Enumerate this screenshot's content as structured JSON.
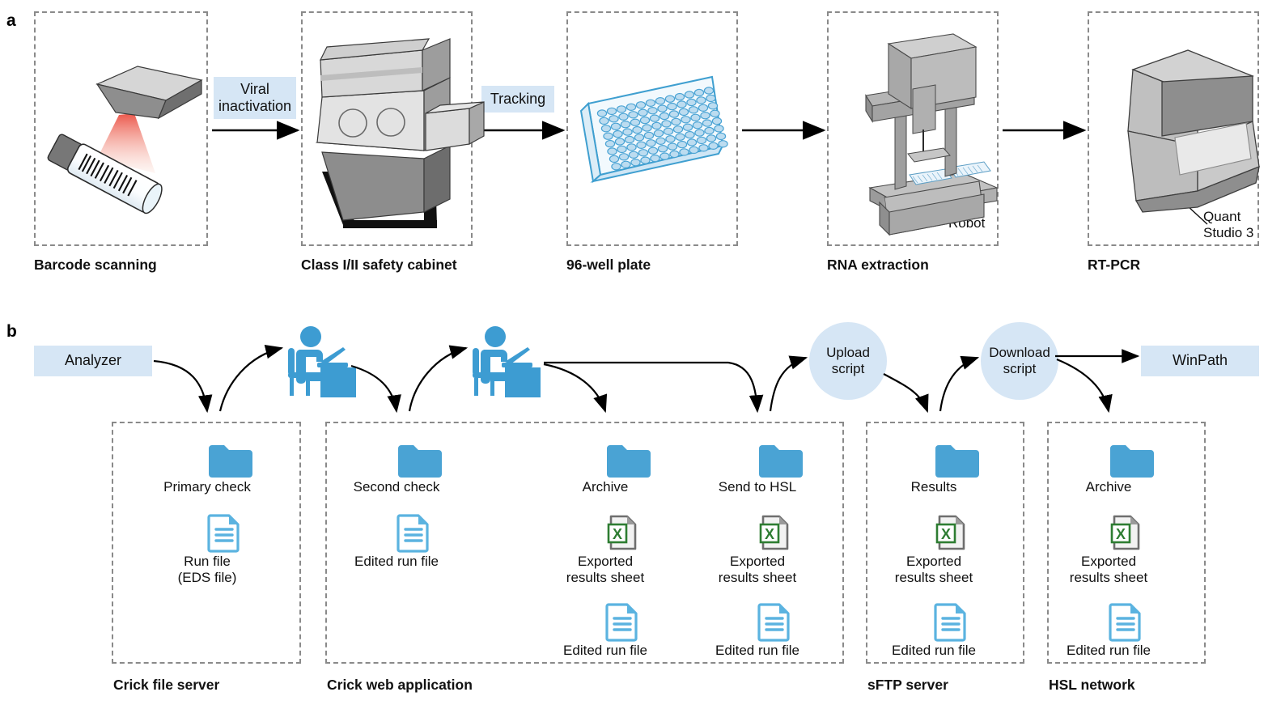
{
  "panels": {
    "a": {
      "letter": "a"
    },
    "b": {
      "letter": "b"
    }
  },
  "workflow_a": {
    "steps": [
      {
        "caption": "Barcode scanning",
        "icon": "barcode-scanner-icon"
      },
      {
        "caption": "Class I/II safety cabinet",
        "icon": "safety-cabinet-icon"
      },
      {
        "caption": "96-well plate",
        "icon": "96-well-plate-icon"
      },
      {
        "caption": "RNA extraction",
        "icon": "robot-extractor-icon",
        "annotation": "Robot"
      },
      {
        "caption": "RT-PCR",
        "icon": "thermocycler-icon",
        "annotation": "Quant\nStudio 3"
      }
    ],
    "arrow_labels": [
      {
        "text": "Viral\ninactivation"
      },
      {
        "text": "Tracking"
      }
    ]
  },
  "workflow_b": {
    "source": {
      "label": "Analyzer"
    },
    "destination": {
      "label": "WinPath"
    },
    "scripts": [
      {
        "label": "Upload\nscript"
      },
      {
        "label": "Download\nscript"
      }
    ],
    "operators": [
      {
        "name": "operator-primary-check",
        "icon": "person-at-desk-icon"
      },
      {
        "name": "operator-second-check",
        "icon": "person-at-desk-icon"
      }
    ],
    "containers": [
      {
        "label": "Crick file server"
      },
      {
        "label": "Crick web application"
      },
      {
        "label": "sFTP server"
      },
      {
        "label": "HSL network"
      }
    ],
    "columns": [
      {
        "folder": "Primary check",
        "files": [
          {
            "type": "document",
            "label": "Run file\n(EDS file)"
          }
        ]
      },
      {
        "folder": "Second check",
        "files": [
          {
            "type": "document",
            "label": "Edited run file"
          }
        ]
      },
      {
        "folder": "Archive",
        "files": [
          {
            "type": "excel",
            "label": "Exported\nresults sheet"
          },
          {
            "type": "document",
            "label": "Edited run file"
          }
        ]
      },
      {
        "folder": "Send to HSL",
        "files": [
          {
            "type": "excel",
            "label": "Exported\nresults sheet"
          },
          {
            "type": "document",
            "label": "Edited run file"
          }
        ]
      },
      {
        "folder": "Results",
        "files": [
          {
            "type": "excel",
            "label": "Exported\nresults sheet"
          },
          {
            "type": "document",
            "label": "Edited run file"
          }
        ]
      },
      {
        "folder": "Archive",
        "files": [
          {
            "type": "excel",
            "label": "Exported\nresults sheet"
          },
          {
            "type": "document",
            "label": "Edited run file"
          }
        ]
      }
    ]
  },
  "colors": {
    "accent_blue": "#d6e6f5",
    "folder_blue": "#4aa3d4",
    "doc_blue": "#5bb3e0",
    "excel_green": "#2e7d32",
    "dash_grey": "#8a8a8a",
    "device_grey": "#b4b4b4"
  }
}
